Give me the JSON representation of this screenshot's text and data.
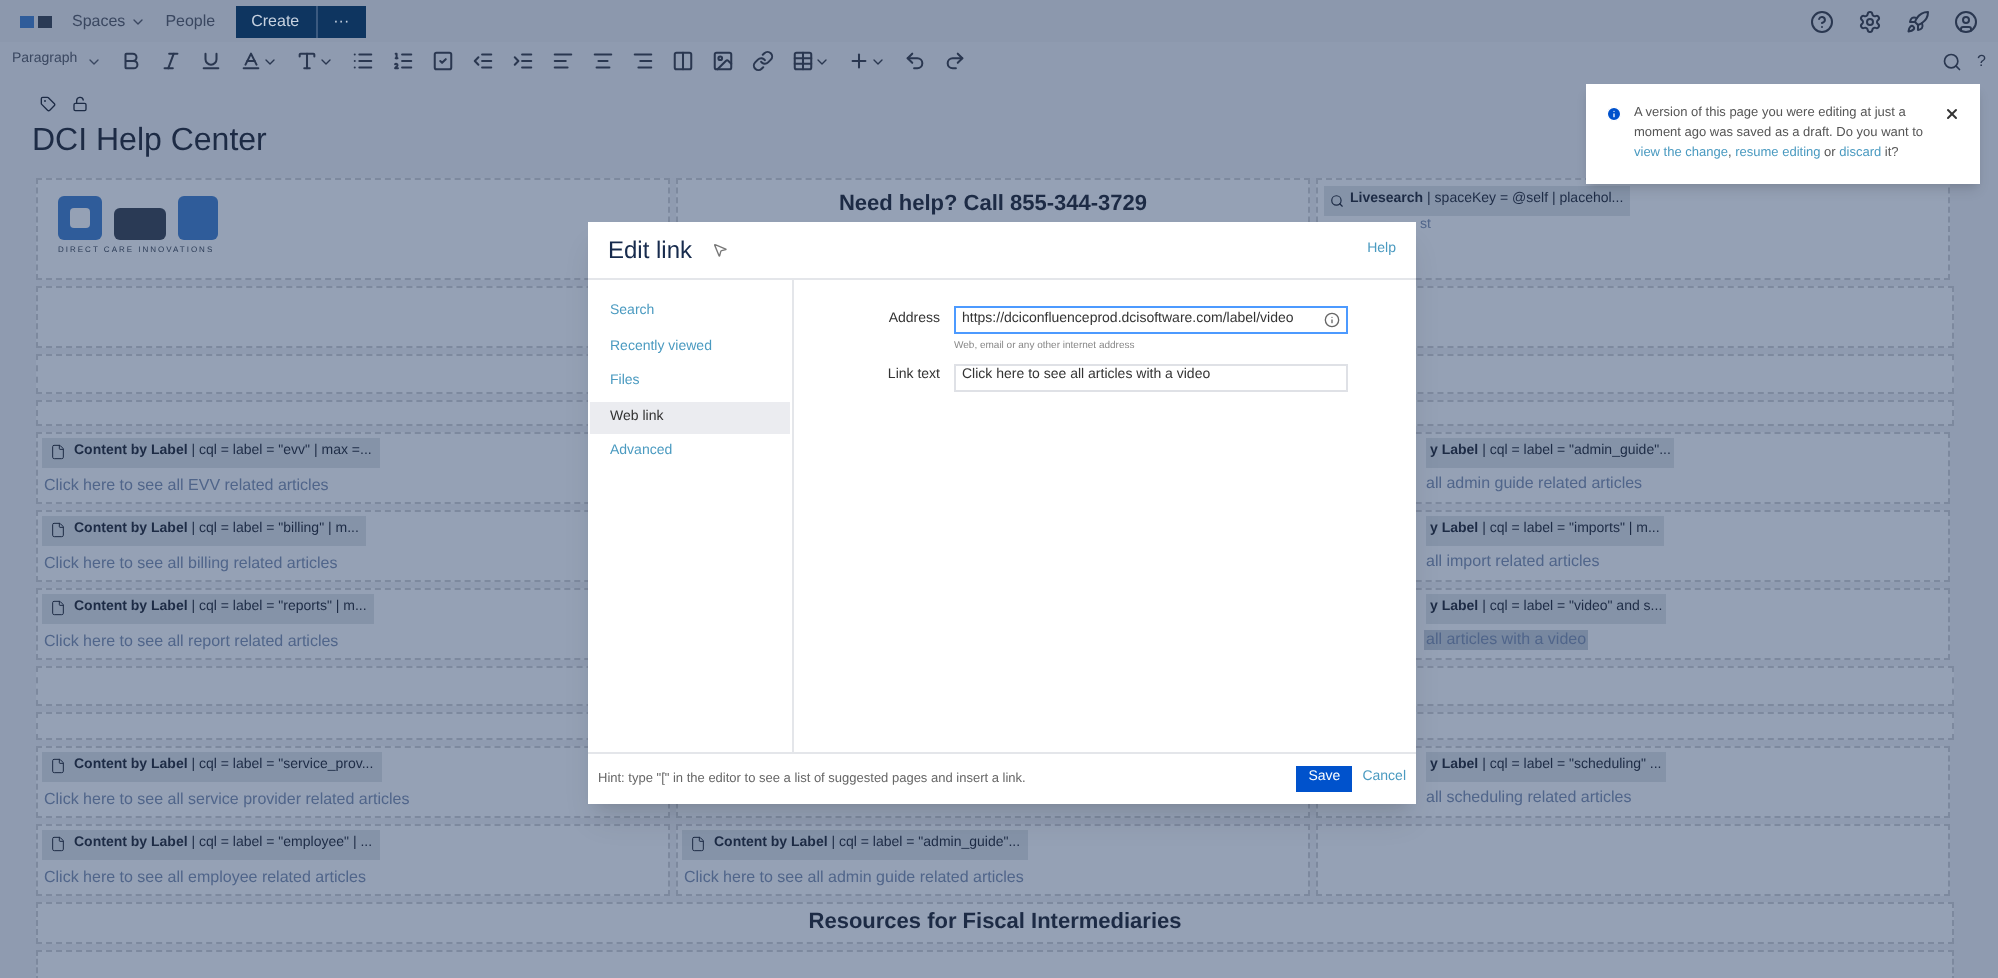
{
  "top_nav": {
    "items": [
      {
        "label": "Spaces",
        "dropdown": true
      },
      {
        "label": "People",
        "dropdown": false
      }
    ],
    "create_button": "Create",
    "more_button": "···"
  },
  "toolbar": {
    "paragraph_style": "Paragraph",
    "help": "?"
  },
  "page": {
    "title": "DCI Help Center",
    "rows": [
      {
        "kind": "cells",
        "cells": [
          {
            "kind": "logo",
            "caption": "DIRECT CARE INNOVATIONS"
          },
          {
            "kind": "heading",
            "text": "Need help? Call 855-344-3729"
          },
          {
            "kind": "search",
            "text": "**Livesearch** | spaceKey = @self | placehol...",
            "fragment": "st"
          }
        ]
      },
      {
        "kind": "empty"
      },
      {
        "kind": "empty"
      },
      {
        "kind": "empty"
      },
      {
        "kind": "cells",
        "cells": [
          {
            "kind": "macro",
            "text": "**Content by Label** | cql = label = \"evv\" | max =...",
            "link": {
              "text": "Click here to see all EVV related articles",
              "highlighted": false
            }
          },
          {
            "kind": "blank"
          },
          {
            "kind": "fragment",
            "text": "**y Label** | cql = label = \"admin_guide\"...",
            "link": {
              "text": "all admin guide related articles",
              "highlighted": false
            }
          }
        ]
      },
      {
        "kind": "cells",
        "cells": [
          {
            "kind": "macro",
            "text": "**Content by Label** | cql = label = \"billing\" | m...",
            "link": {
              "text": "Click here to see all billing related articles",
              "highlighted": false
            }
          },
          {
            "kind": "blank"
          },
          {
            "kind": "fragment",
            "text": "**y Label** | cql = label = \"imports\" | m...",
            "link": {
              "text": "all import related articles",
              "highlighted": false
            }
          }
        ]
      },
      {
        "kind": "cells",
        "cells": [
          {
            "kind": "macro",
            "text": "**Content by Label** | cql = label = \"reports\" | m...",
            "link": {
              "text": "Click here to see all report related articles",
              "highlighted": false
            }
          },
          {
            "kind": "blank"
          },
          {
            "kind": "fragment",
            "text": "**y Label** | cql = label = \"video\" and s...",
            "link": {
              "text": "all articles with a video",
              "highlighted": true
            }
          }
        ]
      },
      {
        "kind": "empty"
      },
      {
        "kind": "empty"
      },
      {
        "kind": "cells",
        "cells": [
          {
            "kind": "macro",
            "text": "**Content by Label** | cql = label = \"service_prov...",
            "link": {
              "text": "Click here to see all service provider related articles",
              "highlighted": false
            }
          },
          {
            "kind": "blank"
          },
          {
            "kind": "fragment",
            "text": "**y Label** | cql = label = \"scheduling\" ...",
            "link": {
              "text": "all scheduling related articles",
              "highlighted": false
            }
          }
        ]
      },
      {
        "kind": "cells",
        "cells": [
          {
            "kind": "macro",
            "text": "**Content by Label** | cql = label = \"employee\" | ...",
            "link": {
              "text": "Click here to see all employee related articles",
              "highlighted": false
            }
          },
          {
            "kind": "macro",
            "text": "**Content by Label** | cql = label = \"admin_guide\"...",
            "link": {
              "text": "Click here to see all admin guide related articles",
              "highlighted": false
            }
          },
          {
            "kind": "blank"
          }
        ]
      },
      {
        "kind": "heading",
        "text": "Resources for Fiscal Intermediaries"
      },
      {
        "kind": "empty"
      }
    ]
  },
  "dialog": {
    "title": "Edit link",
    "help": "Help",
    "tabs": [
      {
        "label": "Search",
        "selected": false
      },
      {
        "label": "Recently viewed",
        "selected": false
      },
      {
        "label": "Files",
        "selected": false
      },
      {
        "label": "Web link",
        "selected": true
      },
      {
        "label": "Advanced",
        "selected": false
      }
    ],
    "address": {
      "label": "Address",
      "value": "https://dciconfluenceprod.dcisoftware.com/label/video",
      "hint": "Web, email or any other internet address"
    },
    "link_text": {
      "label": "Link text",
      "value": "Click here to see all articles with a video"
    },
    "footer_hint": "Hint: type \"[\" in the editor to see a list of suggested pages and insert a link.",
    "save": "Save",
    "cancel": "Cancel"
  },
  "notification": {
    "parts": [
      {
        "kind": "text",
        "text": "A version of this page you were editing at just a moment ago was saved as a draft. Do you want to "
      },
      {
        "kind": "link",
        "text": "view the change"
      },
      {
        "kind": "text",
        "text": ", "
      },
      {
        "kind": "link",
        "text": "resume editing"
      },
      {
        "kind": "text",
        "text": " or "
      },
      {
        "kind": "link",
        "text": "discard"
      },
      {
        "kind": "text",
        "text": " it?"
      }
    ]
  }
}
